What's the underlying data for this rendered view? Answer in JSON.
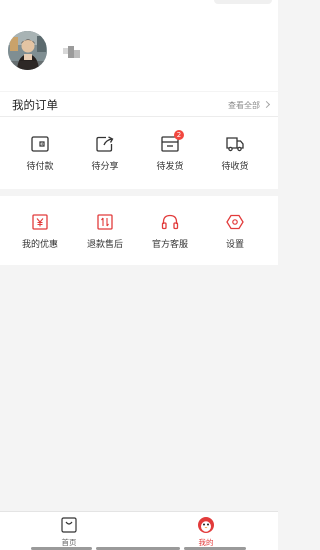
{
  "colors": {
    "accent": "#e23b3b",
    "badge": "#f2473f",
    "background": "#f4f4f4"
  },
  "profile": {
    "avatar_icon": "user-avatar-photo"
  },
  "orders": {
    "title": "我的订单",
    "view_all": "查看全部",
    "items": [
      {
        "label": "待付款",
        "icon": "wallet-icon"
      },
      {
        "label": "待分享",
        "icon": "share-icon"
      },
      {
        "label": "待发货",
        "icon": "package-icon",
        "badge": "2"
      },
      {
        "label": "待收货",
        "icon": "truck-icon"
      }
    ]
  },
  "services": {
    "items": [
      {
        "label": "我的优惠",
        "icon": "coupon-icon"
      },
      {
        "label": "退款售后",
        "icon": "refund-icon"
      },
      {
        "label": "官方客服",
        "icon": "headset-icon"
      },
      {
        "label": "设置",
        "icon": "settings-icon"
      }
    ]
  },
  "tabbar": {
    "items": [
      {
        "label": "首页",
        "icon": "shopping-bag-icon",
        "active": false
      },
      {
        "label": "我的",
        "icon": "penguin-icon",
        "active": true
      }
    ]
  }
}
